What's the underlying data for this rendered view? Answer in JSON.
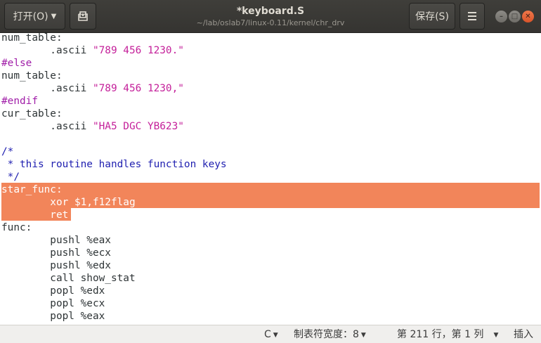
{
  "header": {
    "open_label": "打开(O)",
    "save_label": "保存(S)",
    "title": "*keyboard.S",
    "path": "~/lab/oslab7/linux-0.11/kernel/chr_drv"
  },
  "editor": {
    "lines": [
      [
        {
          "t": "num_table:",
          "c": ""
        }
      ],
      [
        {
          "t": "        .ascii ",
          "c": ""
        },
        {
          "t": "\"789 456 1230.\"",
          "c": "str"
        }
      ],
      [
        {
          "t": "#else",
          "c": "pre"
        }
      ],
      [
        {
          "t": "num_table:",
          "c": ""
        }
      ],
      [
        {
          "t": "        .ascii ",
          "c": ""
        },
        {
          "t": "\"789 456 1230,\"",
          "c": "str"
        }
      ],
      [
        {
          "t": "#endif",
          "c": "pre"
        }
      ],
      [
        {
          "t": "cur_table:",
          "c": ""
        }
      ],
      [
        {
          "t": "        .ascii ",
          "c": ""
        },
        {
          "t": "\"HA5 DGC YB623\"",
          "c": "str"
        }
      ],
      [
        {
          "t": "",
          "c": ""
        }
      ],
      [
        {
          "t": "/*",
          "c": "com"
        }
      ],
      [
        {
          "t": " * this routine handles function keys",
          "c": "com"
        }
      ],
      [
        {
          "t": " */",
          "c": "com"
        }
      ],
      [
        {
          "t": "star_func:",
          "c": ""
        }
      ],
      [
        {
          "t": "        xor $1,f12flag",
          "c": ""
        }
      ],
      [
        {
          "t": "        ret",
          "c": ""
        }
      ],
      [
        {
          "t": "func:",
          "c": ""
        }
      ],
      [
        {
          "t": "        pushl %eax",
          "c": ""
        }
      ],
      [
        {
          "t": "        pushl %ecx",
          "c": ""
        }
      ],
      [
        {
          "t": "        pushl %edx",
          "c": ""
        }
      ],
      [
        {
          "t": "        call show_stat",
          "c": ""
        }
      ],
      [
        {
          "t": "        popl %edx",
          "c": ""
        }
      ],
      [
        {
          "t": "        popl %ecx",
          "c": ""
        }
      ],
      [
        {
          "t": "        popl %eax",
          "c": ""
        }
      ]
    ],
    "selected_lines": [
      12,
      13,
      14
    ],
    "selection_color": "#f2855a"
  },
  "status": {
    "language": "C",
    "tab_width": "制表符宽度：8",
    "position": "第 211 行，第 1 列",
    "mode": "插入"
  },
  "colors": {
    "header_bg": "#3c3b37",
    "string": "#c4209a",
    "preprocessor": "#a01da8",
    "comment": "#1f1fb0"
  },
  "icons": [
    "new-tab-icon",
    "hamburger-menu-icon",
    "minimize-icon",
    "maximize-icon",
    "close-icon",
    "dropdown-caret-icon"
  ]
}
